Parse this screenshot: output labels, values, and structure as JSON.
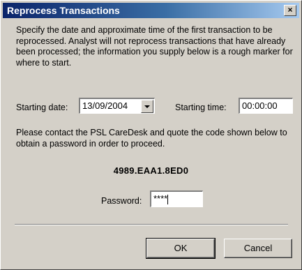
{
  "window": {
    "title": "Reprocess Transactions",
    "close_glyph": "×",
    "close_icon": "close-icon"
  },
  "intro_text": "Specify the date and approximate time of the first transaction to be reprocessed. Analyst will not reprocess transactions that have already been processed; the information you supply below is a rough marker for where to start.",
  "start": {
    "date_label": "Starting date:",
    "date_value": "13/09/2004",
    "dropdown_icon": "chevron-down-icon",
    "time_label": "Starting time:",
    "time_value": "00:00:00"
  },
  "contact_text": "Please contact the PSL CareDesk and quote the code shown below to obtain a password in order to proceed.",
  "code": "4989.EAA1.8ED0",
  "password": {
    "label": "Password:",
    "masked_value": "****"
  },
  "buttons": {
    "ok_label": "OK",
    "cancel_label": "Cancel"
  }
}
